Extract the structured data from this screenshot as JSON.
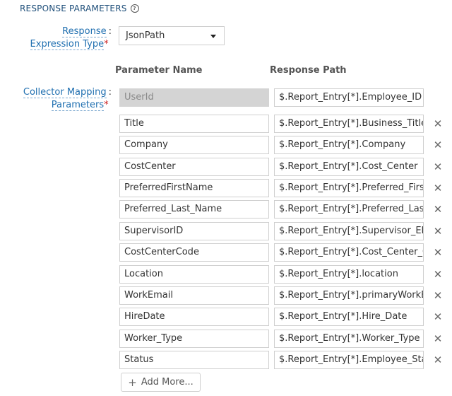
{
  "section": {
    "title": "RESPONSE PARAMETERS",
    "help_icon": "question-circle-icon"
  },
  "response_expression": {
    "label_line1": "Response",
    "label_line2": "Expression Type",
    "required_mark": "*",
    "colon": ":",
    "selected_value": "JsonPath"
  },
  "collector_mapping": {
    "label_line1": "Collector Mapping",
    "label_line2": "Parameters",
    "required_mark": "*",
    "colon": ":"
  },
  "columns": {
    "name_header": "Parameter Name",
    "path_header": "Response Path"
  },
  "rows": [
    {
      "name": "UserId",
      "path": "$.Report_Entry[*].Employee_ID",
      "locked": true
    },
    {
      "name": "Title",
      "path": "$.Report_Entry[*].Business_Title"
    },
    {
      "name": "Company",
      "path": "$.Report_Entry[*].Company"
    },
    {
      "name": "CostCenter",
      "path": "$.Report_Entry[*].Cost_Center"
    },
    {
      "name": "PreferredFirstName",
      "path": "$.Report_Entry[*].Preferred_First_"
    },
    {
      "name": "Preferred_Last_Name",
      "path": "$.Report_Entry[*].Preferred_Last_"
    },
    {
      "name": "SupervisorID",
      "path": "$.Report_Entry[*].Supervisor_EE_"
    },
    {
      "name": "CostCenterCode",
      "path": "$.Report_Entry[*].Cost_Center_Cc"
    },
    {
      "name": "Location",
      "path": "$.Report_Entry[*].location"
    },
    {
      "name": "WorkEmail",
      "path": "$.Report_Entry[*].primaryWorkEr"
    },
    {
      "name": "HireDate",
      "path": "$.Report_Entry[*].Hire_Date"
    },
    {
      "name": "Worker_Type",
      "path": "$.Report_Entry[*].Worker_Type"
    },
    {
      "name": "Status",
      "path": "$.Report_Entry[*].Employee_Statu"
    }
  ],
  "remove_icon": "close-icon",
  "remove_glyph": "✕",
  "add_more": {
    "plus": "+",
    "label": "Add More..."
  }
}
